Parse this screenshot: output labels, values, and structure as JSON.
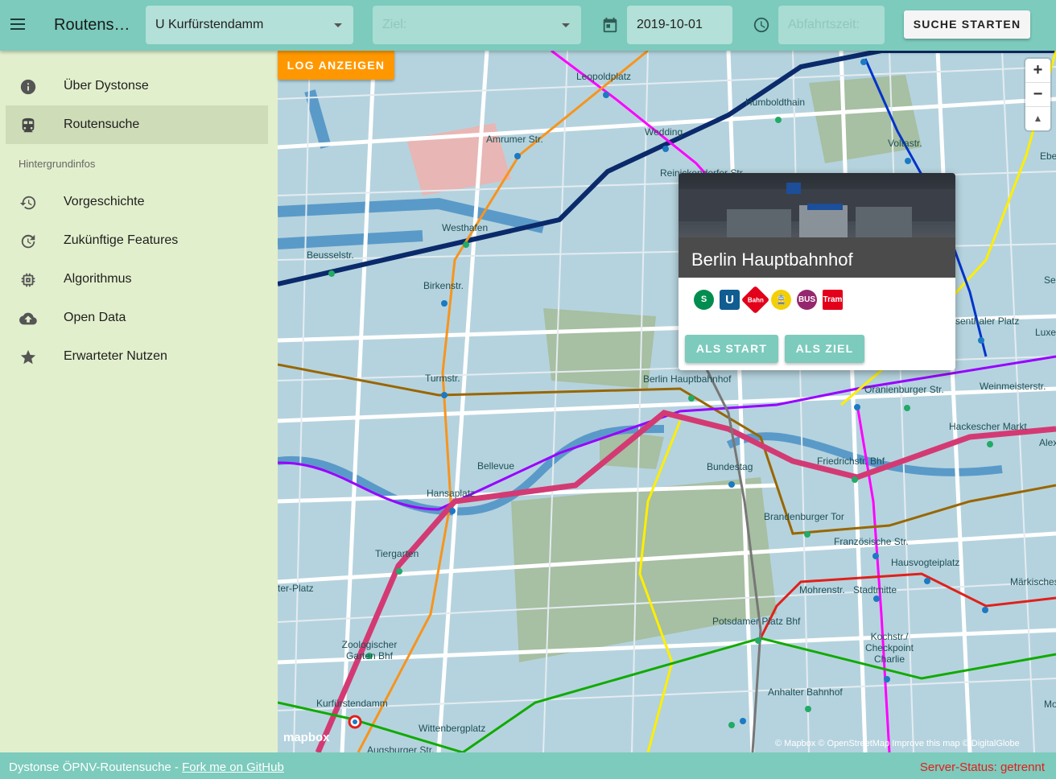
{
  "header": {
    "app_title": "Routensuche",
    "start_value": "U Kurfürstendamm",
    "ziel_placeholder": "Ziel:",
    "date_value": "2019-10-01",
    "time_placeholder": "Abfahrtszeit:",
    "search_label": "SUCHE STARTEN"
  },
  "sidebar": {
    "items": [
      {
        "label": "Über Dystonse",
        "icon": "info-icon"
      },
      {
        "label": "Routensuche",
        "icon": "train-icon",
        "active": true
      }
    ],
    "section_header": "Hintergrundinfos",
    "background_items": [
      {
        "label": "Vorgeschichte",
        "icon": "history-icon"
      },
      {
        "label": "Zukünftige Features",
        "icon": "update-icon"
      },
      {
        "label": "Algorithmus",
        "icon": "chip-icon"
      },
      {
        "label": "Open Data",
        "icon": "cloud-upload-icon"
      },
      {
        "label": "Erwarteter Nutzen",
        "icon": "star-icon"
      }
    ]
  },
  "map": {
    "log_button": "LOG ANZEIGEN",
    "zoom_in": "+",
    "zoom_out": "−",
    "compass": "▲",
    "mapbox_logo": "mapbox",
    "attribution": "© Mapbox © OpenStreetMap Improve this map © DigitalGlobe",
    "labels": [
      "Leopoldplatz",
      "Humboldthain",
      "Voltastr.",
      "Amrumer Str.",
      "Wedding",
      "Reinickendorfer Str.",
      "Westhafen",
      "Beusselstr.",
      "Birkenstr.",
      "Turmstr.",
      "Berlin Hauptbahnhof",
      "Oranienburger Str.",
      "Weinmeisterstr.",
      "Hackescher Markt",
      "Bellevue",
      "Hansaplatz",
      "Bundestag",
      "Friedrichstr. Bhf",
      "Brandenburger Tor",
      "Französische Str.",
      "Hausvogteiplatz",
      "Tiergarten",
      "Mohrenstr.",
      "Stadtmitte",
      "Märkisches",
      "Potsdamer Platz Bhf",
      "Kochstr./ Checkpoint Charlie",
      "Zoologischer Garten Bhf",
      "Anhalter Bahnhof",
      "Kurfürstendamm",
      "Wittenbergplatz",
      "Augsburger Str.",
      "Alexan",
      "Ebe",
      "Se",
      "Luxe",
      "Mo",
      "senthaler Platz",
      "ter-Platz"
    ]
  },
  "popup": {
    "title": "Berlin Hauptbahnhof",
    "transport_badges": [
      {
        "text": "S",
        "color": "#008d4f"
      },
      {
        "text": "U",
        "color": "#115d91"
      },
      {
        "text": "Bahn",
        "color": "#e2001a"
      },
      {
        "text": "🚊",
        "color": "#f4d000"
      },
      {
        "text": "BUS",
        "color": "#95276e"
      },
      {
        "text": "Tram",
        "color": "#e2001a"
      }
    ],
    "start_button": "ALS START",
    "ziel_button": "ALS ZIEL"
  },
  "footer": {
    "text": "Dystonse ÖPNV-Routensuche - ",
    "github_link": "Fork me on GitHub",
    "server_status": "Server-Status: getrennt"
  }
}
